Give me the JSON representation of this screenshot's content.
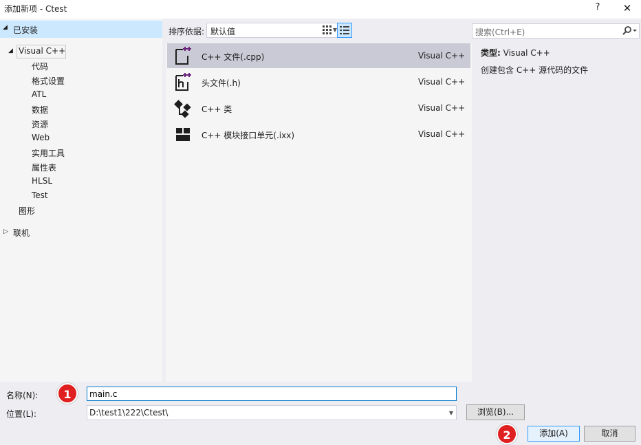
{
  "window": {
    "title": "添加新项 - Ctest",
    "help_glyph": "?",
    "close_glyph": "✕"
  },
  "tree": {
    "installed": "已安装",
    "visual_cpp": "Visual C++",
    "children": [
      "代码",
      "格式设置",
      "ATL",
      "数据",
      "资源",
      "Web",
      "实用工具",
      "属性表",
      "HLSL",
      "Test"
    ],
    "graphics": "图形",
    "online": "联机"
  },
  "toolbar": {
    "sort_label": "排序依据:",
    "sort_value": "默认值"
  },
  "templates": [
    {
      "name": "C++ 文件(.cpp)",
      "lang": "Visual C++",
      "icon": "cpp-file-icon",
      "selected": true
    },
    {
      "name": "头文件(.h)",
      "lang": "Visual C++",
      "icon": "header-file-icon",
      "selected": false
    },
    {
      "name": "C++ 类",
      "lang": "Visual C++",
      "icon": "class-icon",
      "selected": false
    },
    {
      "name": "C++ 模块接口单元(.ixx)",
      "lang": "Visual C++",
      "icon": "module-icon",
      "selected": false
    }
  ],
  "search": {
    "placeholder": "搜索(Ctrl+E)"
  },
  "info": {
    "type_label": "类型:",
    "type_value": "Visual C++",
    "description": "创建包含 C++ 源代码的文件"
  },
  "form": {
    "name_label": "名称(N):",
    "name_value": "main.c",
    "location_label": "位置(L):",
    "location_value": "D:\\test1\\222\\Ctest\\",
    "browse": "浏览(B)...",
    "add": "添加(A)",
    "cancel": "取消"
  },
  "badges": {
    "one": "1",
    "two": "2"
  },
  "colors": {
    "selection": "#cce8ff",
    "selected_template": "#cacad6",
    "accent": "#007acc",
    "badge": "#e02020",
    "icon_purple": "#68217a"
  }
}
